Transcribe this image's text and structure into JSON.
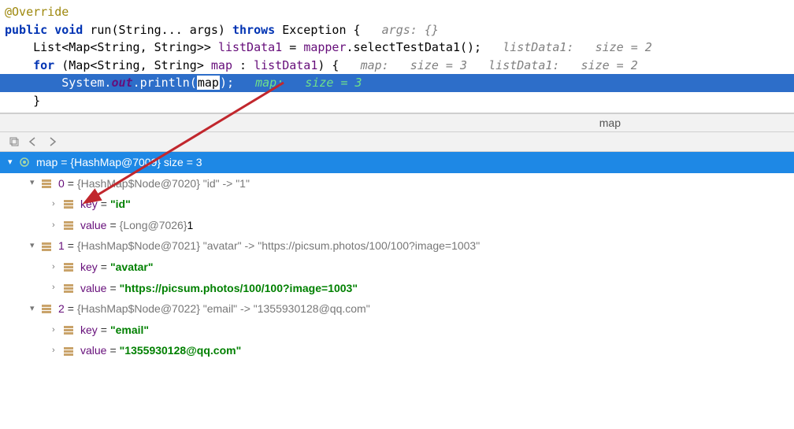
{
  "code": {
    "l1_anno": "@Override",
    "l2_public": "public",
    "l2_void": "void",
    "l2_rest": " run(String... args) ",
    "l2_throws": "throws",
    "l2_exc": " Exception {   ",
    "l2_hint": "args: {}",
    "l3": "",
    "l4a": "    List<Map<String, String>> ",
    "l4b": "listData1",
    "l4c": " = ",
    "l4d": "mapper",
    "l4e": ".selectTestData1();   ",
    "l4_hint": "listData1:   size = 2",
    "l5_for": "    for",
    "l5a": " (Map<String, String> ",
    "l5b": "map",
    "l5c": " : ",
    "l5d": "listData1",
    "l5e": ") {   ",
    "l5_hint": "map:   size = 3   listData1:   size = 2",
    "l6a": "        System.",
    "l6b": "out",
    "l6c": ".println(",
    "l6d": "map",
    "l6e": ");   ",
    "l6_hint": "map:   size = 3",
    "l7": "    }"
  },
  "debugbar": {
    "variable": "map"
  },
  "tree": {
    "root": {
      "name": "map",
      "eq": " = ",
      "val": "{HashMap@7009}  size = 3"
    },
    "n0": {
      "name": "0",
      "eq": " = ",
      "val": "{HashMap$Node@7020}  \"id\" -> \"1\""
    },
    "n0_key": {
      "name": "key",
      "eq": " = ",
      "val": "\"id\""
    },
    "n0_val": {
      "name": "value",
      "eq": " = ",
      "valgray": "{Long@7026} ",
      "valtext": "1"
    },
    "n1": {
      "name": "1",
      "eq": " = ",
      "val": "{HashMap$Node@7021}  \"avatar\" -> \"https://picsum.photos/100/100?image=1003\""
    },
    "n1_key": {
      "name": "key",
      "eq": " = ",
      "val": "\"avatar\""
    },
    "n1_val": {
      "name": "value",
      "eq": " = ",
      "val": "\"https://picsum.photos/100/100?image=1003\""
    },
    "n2": {
      "name": "2",
      "eq": " = ",
      "val": "{HashMap$Node@7022}  \"email\" -> \"1355930128@qq.com\""
    },
    "n2_key": {
      "name": "key",
      "eq": " = ",
      "val": "\"email\""
    },
    "n2_val": {
      "name": "value",
      "eq": " = ",
      "val": "\"1355930128@qq.com\""
    }
  }
}
